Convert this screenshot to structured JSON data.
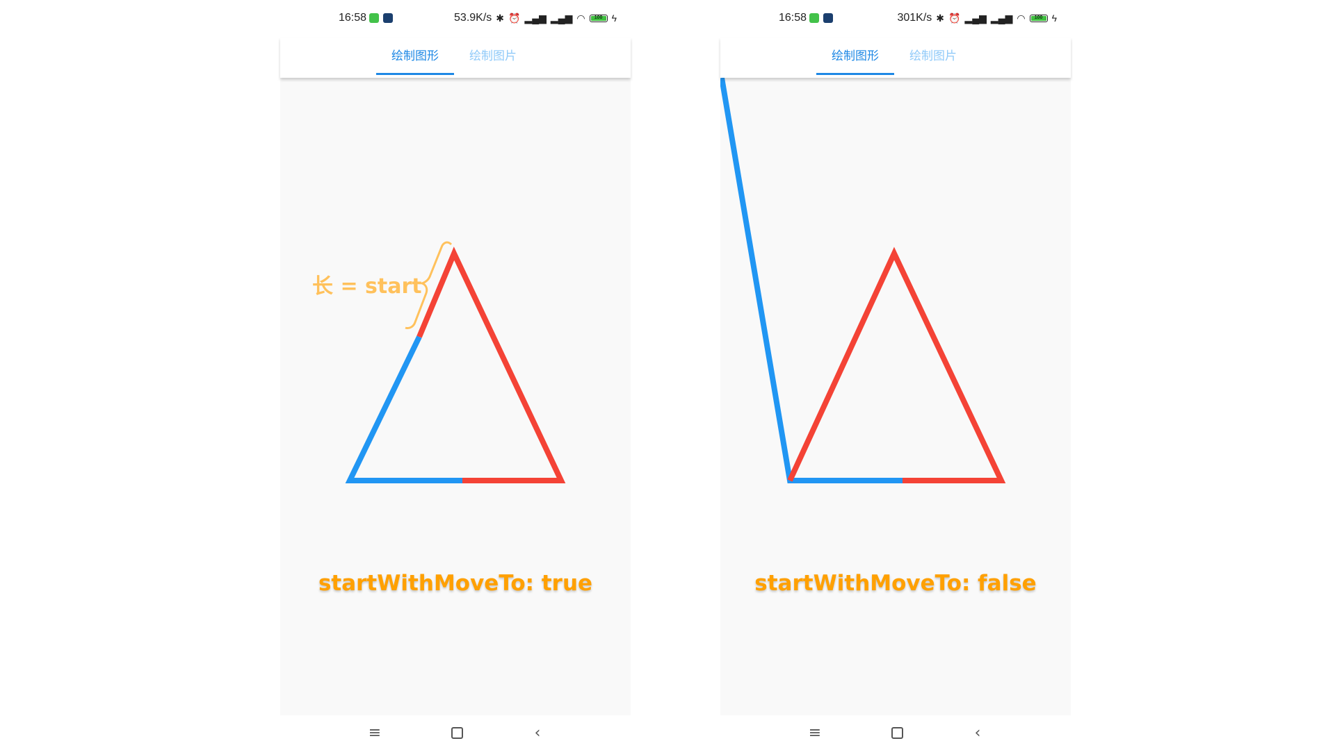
{
  "screens": [
    {
      "status": {
        "time": "16:58",
        "speed": "53.9K/s",
        "battery": "100"
      },
      "tabs": [
        "绘制图形",
        "绘制图片"
      ],
      "active_tab": 0,
      "annotation": "长 = start",
      "caption": "startWithMoveTo: true"
    },
    {
      "status": {
        "time": "16:58",
        "speed": "301K/s",
        "battery": "100"
      },
      "tabs": [
        "绘制图形",
        "绘制图片"
      ],
      "active_tab": 0,
      "caption": "startWithMoveTo: false"
    }
  ],
  "colors": {
    "accent_blue": "#1e88e5",
    "inactive_tab": "#90caf9",
    "path_blue": "#2196f3",
    "path_red": "#f44336",
    "caption_orange": "#ffa000",
    "annotation_orange": "#ffc15c"
  },
  "icons": {
    "statusbar": [
      "app-icon-green",
      "app-icon-blue",
      "bluetooth-icon",
      "alarm-icon",
      "signal-hd-icon",
      "signal-hd-icon",
      "wifi-icon",
      "battery-icon",
      "charging-icon"
    ],
    "navbar": [
      "menu-icon",
      "home-icon",
      "back-icon"
    ]
  }
}
